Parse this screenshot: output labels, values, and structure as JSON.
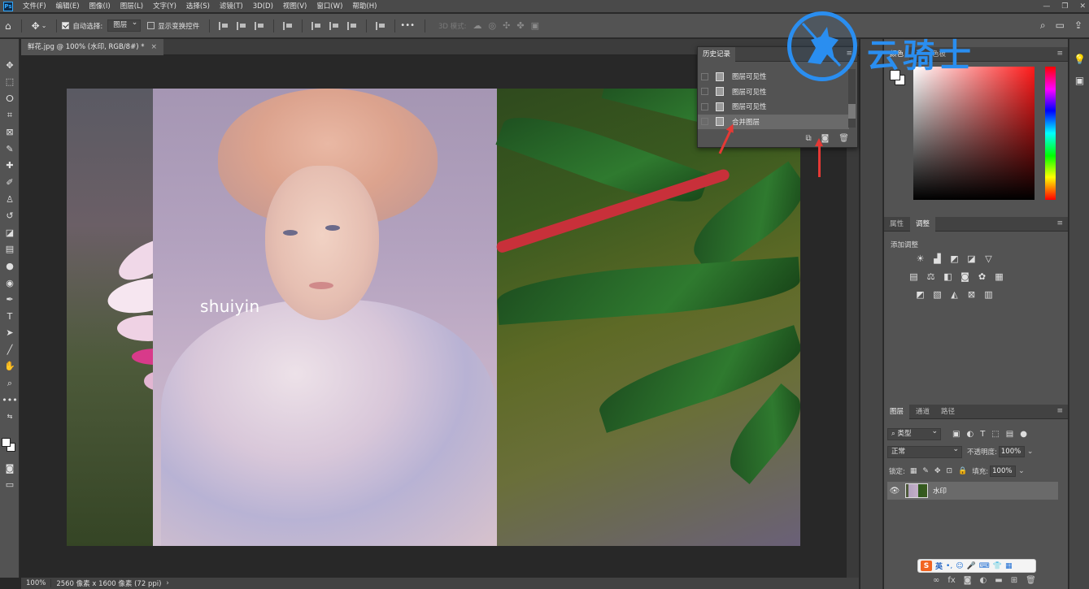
{
  "app": {
    "logo_text": "Ps",
    "menu": [
      "文件(F)",
      "编辑(E)",
      "图像(I)",
      "图层(L)",
      "文字(Y)",
      "选择(S)",
      "滤镜(T)",
      "3D(D)",
      "视图(V)",
      "窗口(W)",
      "帮助(H)"
    ],
    "window_controls": [
      "—",
      "❐",
      "✕"
    ]
  },
  "options": {
    "auto_select_label": "自动选择:",
    "auto_select_value": "图层",
    "show_transform_label": "显示变换控件",
    "more": "•••",
    "mode_3d": "3D 模式:"
  },
  "document": {
    "tab_title": "鲜花.jpg @ 100% (水印, RGB/8#) *",
    "tab_close": "×",
    "watermark": "shuiyin"
  },
  "history": {
    "tab_label": "历史记录",
    "menu_icon": "≡",
    "items": [
      {
        "label": "图层可见性",
        "active": false
      },
      {
        "label": "图层可见性",
        "active": false
      },
      {
        "label": "图层可见性",
        "active": false
      },
      {
        "label": "合并图层",
        "active": true
      }
    ]
  },
  "color_panel": {
    "tab_label": "颜色",
    "tab2_label": "色板",
    "menu_icon": "≡"
  },
  "adjust_panel": {
    "tab_properties": "属性",
    "tab_adjust": "调整",
    "add_label": "添加调整",
    "menu_icon": "≡"
  },
  "layers_panel": {
    "tab_layers": "图层",
    "tab_channels": "通道",
    "tab_paths": "路径",
    "menu_icon": "≡",
    "filter_kind": "类型",
    "blend_mode": "正常",
    "opacity_label": "不透明度:",
    "opacity_value": "100%",
    "lock_label": "锁定:",
    "fill_label": "填充:",
    "fill_value": "100%",
    "layers": [
      {
        "name": "水印",
        "visible": true
      }
    ]
  },
  "status": {
    "zoom": "100%",
    "info": "2560 像素 x 1600 像素 (72 ppi)",
    "caret": "›"
  },
  "ime": {
    "brand": "S",
    "lang": "英"
  },
  "brand_logo": {
    "text": "云骑士"
  },
  "colors": {
    "accent_blue": "#2a8ef0",
    "annotation_red": "#e53935",
    "panel_bg": "#535353",
    "canvas_bg": "#282828"
  }
}
